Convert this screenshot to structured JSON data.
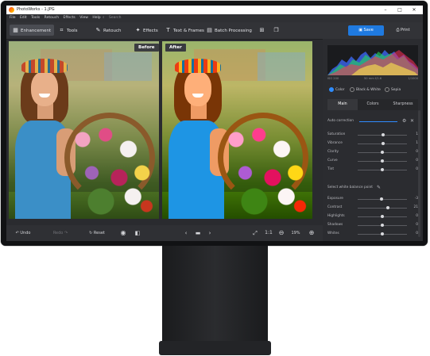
{
  "window": {
    "title": "PhotoWorks - 1.JPG",
    "controls": [
      "–",
      "□",
      "✕"
    ]
  },
  "menu": {
    "items": [
      "File",
      "Edit",
      "Tools",
      "Retouch",
      "Effects",
      "View",
      "Help"
    ],
    "search_placeholder": "Search"
  },
  "toolbar": {
    "tools": [
      {
        "label": "Enhancement",
        "icon": "enhancement-icon",
        "active": true
      },
      {
        "label": "Tools",
        "icon": "crop-icon",
        "active": false
      },
      {
        "label": "Retouch",
        "icon": "brush-icon",
        "active": false
      },
      {
        "label": "Effects",
        "icon": "effects-icon",
        "active": false
      },
      {
        "label": "Text & Frames",
        "icon": "text-icon",
        "active": false
      },
      {
        "label": "Batch Processing",
        "icon": "batch-icon",
        "active": false
      }
    ],
    "save_label": "Save",
    "print_label": "Print"
  },
  "compare": {
    "before_label": "Before",
    "after_label": "After"
  },
  "bottombar": {
    "undo_label": "Undo",
    "redo_label": "Redo",
    "reset_label": "Reset",
    "zoom_ratio": "1:1",
    "zoom_percent": "19%"
  },
  "histogram": {
    "left_info": "ISO 200",
    "mid_info": "50 mm f/1.6",
    "right_info": "1/1000"
  },
  "color_modes": [
    {
      "label": "Color",
      "selected": true
    },
    {
      "label": "Black & White",
      "selected": false
    },
    {
      "label": "Sepia",
      "selected": false
    }
  ],
  "panel_tabs": [
    {
      "label": "Main",
      "active": true
    },
    {
      "label": "Colors",
      "active": false
    },
    {
      "label": "Sharpness",
      "active": false
    }
  ],
  "auto_correction_label": "Auto correction",
  "adjustments": [
    {
      "label": "Saturation",
      "value": "1",
      "level": 0.52
    },
    {
      "label": "Vibrance",
      "value": "1",
      "level": 0.52
    },
    {
      "label": "Clarity",
      "value": "0",
      "level": 0.5
    },
    {
      "label": "Curve",
      "value": "0",
      "level": 0.5
    },
    {
      "label": "Tint",
      "value": "0",
      "level": 0.5
    }
  ],
  "white_balance_label": "Select white balance point",
  "tone": [
    {
      "label": "Exposure",
      "value": "-3",
      "level": 0.48
    },
    {
      "label": "Contrast",
      "value": "21",
      "level": 0.62
    },
    {
      "label": "Highlights",
      "value": "0",
      "level": 0.5
    },
    {
      "label": "Shadows",
      "value": "0",
      "level": 0.5
    },
    {
      "label": "Whites",
      "value": "0",
      "level": 0.5
    }
  ],
  "colors": {
    "accent": "#1f7ae0",
    "toolbar_bg": "#323337",
    "panel_bg": "#2b2c30"
  }
}
